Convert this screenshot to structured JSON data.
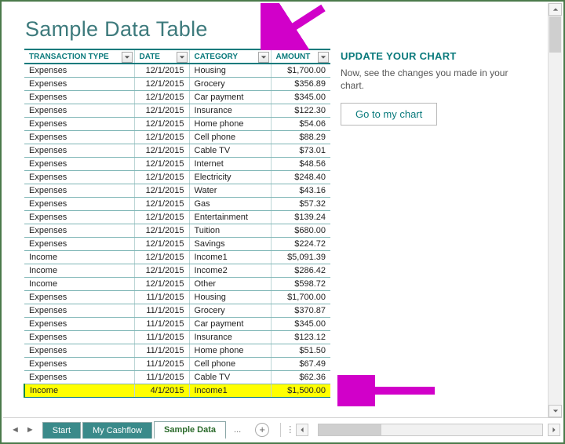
{
  "header": {
    "title": "Sample Data Table"
  },
  "side": {
    "heading": "UPDATE YOUR CHART",
    "text": "Now, see the changes you made in your chart.",
    "button": "Go to my chart"
  },
  "tabs": [
    "Start",
    "My Cashflow",
    "Sample Data"
  ],
  "tabs_more": "...",
  "table": {
    "columns": [
      "TRANSACTION TYPE",
      "DATE",
      "CATEGORY",
      "AMOUNT"
    ],
    "rows": [
      {
        "type": "Expenses",
        "date": "12/1/2015",
        "category": "Housing",
        "amount": "$1,700.00"
      },
      {
        "type": "Expenses",
        "date": "12/1/2015",
        "category": "Grocery",
        "amount": "$356.89"
      },
      {
        "type": "Expenses",
        "date": "12/1/2015",
        "category": "Car payment",
        "amount": "$345.00"
      },
      {
        "type": "Expenses",
        "date": "12/1/2015",
        "category": "Insurance",
        "amount": "$122.30"
      },
      {
        "type": "Expenses",
        "date": "12/1/2015",
        "category": "Home phone",
        "amount": "$54.06"
      },
      {
        "type": "Expenses",
        "date": "12/1/2015",
        "category": "Cell phone",
        "amount": "$88.29"
      },
      {
        "type": "Expenses",
        "date": "12/1/2015",
        "category": "Cable TV",
        "amount": "$73.01"
      },
      {
        "type": "Expenses",
        "date": "12/1/2015",
        "category": "Internet",
        "amount": "$48.56"
      },
      {
        "type": "Expenses",
        "date": "12/1/2015",
        "category": "Electricity",
        "amount": "$248.40"
      },
      {
        "type": "Expenses",
        "date": "12/1/2015",
        "category": "Water",
        "amount": "$43.16"
      },
      {
        "type": "Expenses",
        "date": "12/1/2015",
        "category": "Gas",
        "amount": "$57.32"
      },
      {
        "type": "Expenses",
        "date": "12/1/2015",
        "category": "Entertainment",
        "amount": "$139.24"
      },
      {
        "type": "Expenses",
        "date": "12/1/2015",
        "category": "Tuition",
        "amount": "$680.00"
      },
      {
        "type": "Expenses",
        "date": "12/1/2015",
        "category": "Savings",
        "amount": "$224.72"
      },
      {
        "type": "Income",
        "date": "12/1/2015",
        "category": "Income1",
        "amount": "$5,091.39"
      },
      {
        "type": "Income",
        "date": "12/1/2015",
        "category": "Income2",
        "amount": "$286.42"
      },
      {
        "type": "Income",
        "date": "12/1/2015",
        "category": "Other",
        "amount": "$598.72"
      },
      {
        "type": "Expenses",
        "date": "11/1/2015",
        "category": "Housing",
        "amount": "$1,700.00"
      },
      {
        "type": "Expenses",
        "date": "11/1/2015",
        "category": "Grocery",
        "amount": "$370.87"
      },
      {
        "type": "Expenses",
        "date": "11/1/2015",
        "category": "Car payment",
        "amount": "$345.00"
      },
      {
        "type": "Expenses",
        "date": "11/1/2015",
        "category": "Insurance",
        "amount": "$123.12"
      },
      {
        "type": "Expenses",
        "date": "11/1/2015",
        "category": "Home phone",
        "amount": "$51.50"
      },
      {
        "type": "Expenses",
        "date": "11/1/2015",
        "category": "Cell phone",
        "amount": "$67.49"
      },
      {
        "type": "Expenses",
        "date": "11/1/2015",
        "category": "Cable TV",
        "amount": "$62.36"
      },
      {
        "type": "Income",
        "date": "4/1/2015",
        "category": "Income1",
        "amount": "$1,500.00",
        "highlight": true
      }
    ]
  }
}
